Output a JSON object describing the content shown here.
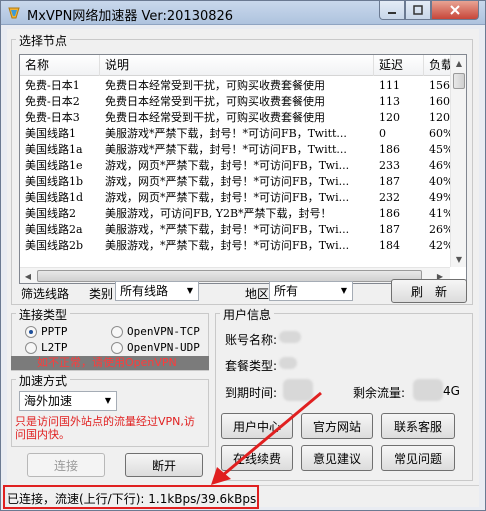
{
  "window": {
    "title": "MxVPN网络加速器 Ver:20130826",
    "min_icon": "minimize-icon",
    "max_icon": "maximize-icon",
    "close_icon": "close-icon"
  },
  "node_group": {
    "label": "选择节点",
    "columns": [
      "名称",
      "说明",
      "延迟",
      "负载"
    ],
    "rows": [
      [
        "免费-日本1",
        "免费日本经常受到干扰，可购买收费套餐使用",
        "111",
        "156"
      ],
      [
        "免费-日本2",
        "免费日本经常受到干扰，可购买收费套餐使用",
        "113",
        "160"
      ],
      [
        "免费-日本3",
        "免费日本经常受到干扰，可购买收费套餐使用",
        "120",
        "120"
      ],
      [
        "美国线路1",
        "美服游戏*严禁下载，封号！*可访问FB，Twitt...",
        "0",
        "60%"
      ],
      [
        "美国线路1a",
        "美服游戏*严禁下载，封号！*可访问FB，Twitt...",
        "186",
        "45%"
      ],
      [
        "美国线路1e",
        "游戏，网页*严禁下载，封号！*可访问FB，Twi...",
        "233",
        "46%"
      ],
      [
        "美国线路1b",
        "游戏，网页*严禁下载，封号！*可访问FB，Twi...",
        "187",
        "40%"
      ],
      [
        "美国线路1d",
        "游戏，网页*严禁下载，封号！*可访问FB，Twi...",
        "232",
        "49%"
      ],
      [
        "美国线路2",
        "美服游戏，可访问FB, Y2B*严禁下载，封号！",
        "186",
        "41%"
      ],
      [
        "美国线路2a",
        "美服游戏，*严禁下载，封号！*可访问FB，Twi...",
        "187",
        "26%"
      ],
      [
        "美国线路2b",
        "美服游戏，*严禁下载，封号！*可访问FB，Twi...",
        "184",
        "42%"
      ]
    ]
  },
  "filter": {
    "label": "筛选线路",
    "category_label": "类别",
    "category_value": "所有线路",
    "region_label": "地区",
    "region_value": "所有",
    "refresh_label": "刷　新"
  },
  "connection_type": {
    "label": "连接类型",
    "options": [
      "PPTP",
      "OpenVPN-TCP",
      "L2TP",
      "OpenVPN-UDP"
    ],
    "selected": "PPTP",
    "warning": "如不正常，请使用OpenVPN"
  },
  "acceleration": {
    "label": "加速方式",
    "value": "海外加速",
    "note": "只是访问国外站点的流量经过VPN,访问国内快。"
  },
  "actions": {
    "connect_label": "连接",
    "disconnect_label": "断开"
  },
  "user_info": {
    "label": "用户信息",
    "account_label": "账号名称:",
    "plan_label": "套餐类型:",
    "expiry_label": "到期时间:",
    "remaining_label": "剩余流量:",
    "remaining_suffix": "4G",
    "buttons": [
      "用户中心",
      "官方网站",
      "联系客服",
      "在线续费",
      "意见建议",
      "常见问题"
    ]
  },
  "status": {
    "text": "已连接，流速(上行/下行): 1.1kBps/39.6kBps"
  },
  "colors": {
    "accent_red": "#e02020",
    "warning_bar": "#7b7b7b"
  }
}
